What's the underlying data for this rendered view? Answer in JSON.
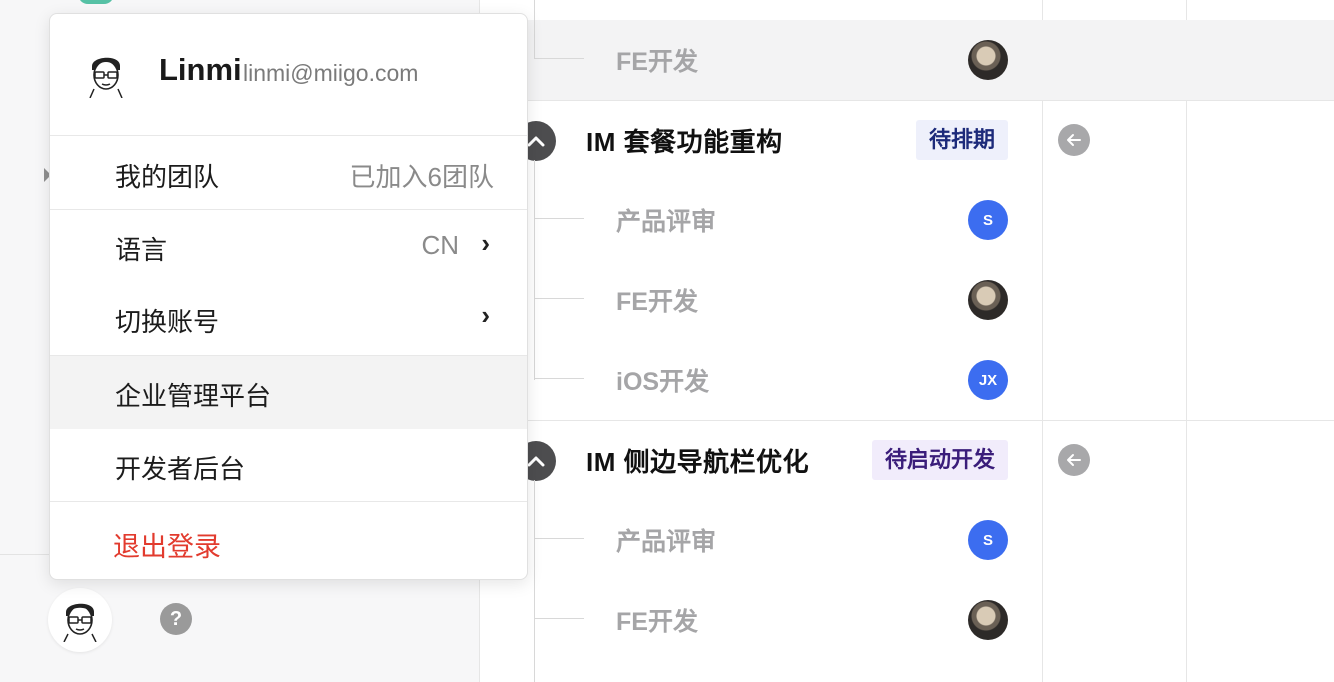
{
  "profile": {
    "name": "Linmi",
    "email": "linmi@miigo.com"
  },
  "menu": {
    "my_team": {
      "label": "我的团队",
      "value": "已加入6团队"
    },
    "language": {
      "label": "语言",
      "value": "CN",
      "arrow": "›"
    },
    "switch_account": {
      "label": "切换账号",
      "arrow": "›"
    },
    "enterprise_admin": {
      "label": "企业管理平台"
    },
    "developer_console": {
      "label": "开发者后台"
    },
    "logout": {
      "label": "退出登录"
    }
  },
  "sidebar": {
    "help_glyph": "?"
  },
  "rows": {
    "r0_task": {
      "label": "FE开发"
    },
    "p1": {
      "title": "IM 套餐功能重构",
      "status": "待排期"
    },
    "p1_t1": {
      "label": "产品评审",
      "assignee": "S"
    },
    "p1_t2": {
      "label": "FE开发"
    },
    "p1_t3": {
      "label": "iOS开发",
      "assignee": "JX"
    },
    "p2": {
      "title": "IM 侧边导航栏优化",
      "status": "待启动开发"
    },
    "p2_t1": {
      "label": "产品评审",
      "assignee": "S"
    },
    "p2_t2": {
      "label": "FE开发"
    }
  },
  "colors": {
    "accent_blue": "#3c6df0",
    "danger": "#e23b2e",
    "badge_blue_bg": "#eef0fb",
    "badge_purple_bg": "#f1ecfb"
  },
  "icons": [
    "chevron-up-icon",
    "arrow-left-icon",
    "help-icon",
    "user-avatar",
    "chevron-right-icon"
  ]
}
